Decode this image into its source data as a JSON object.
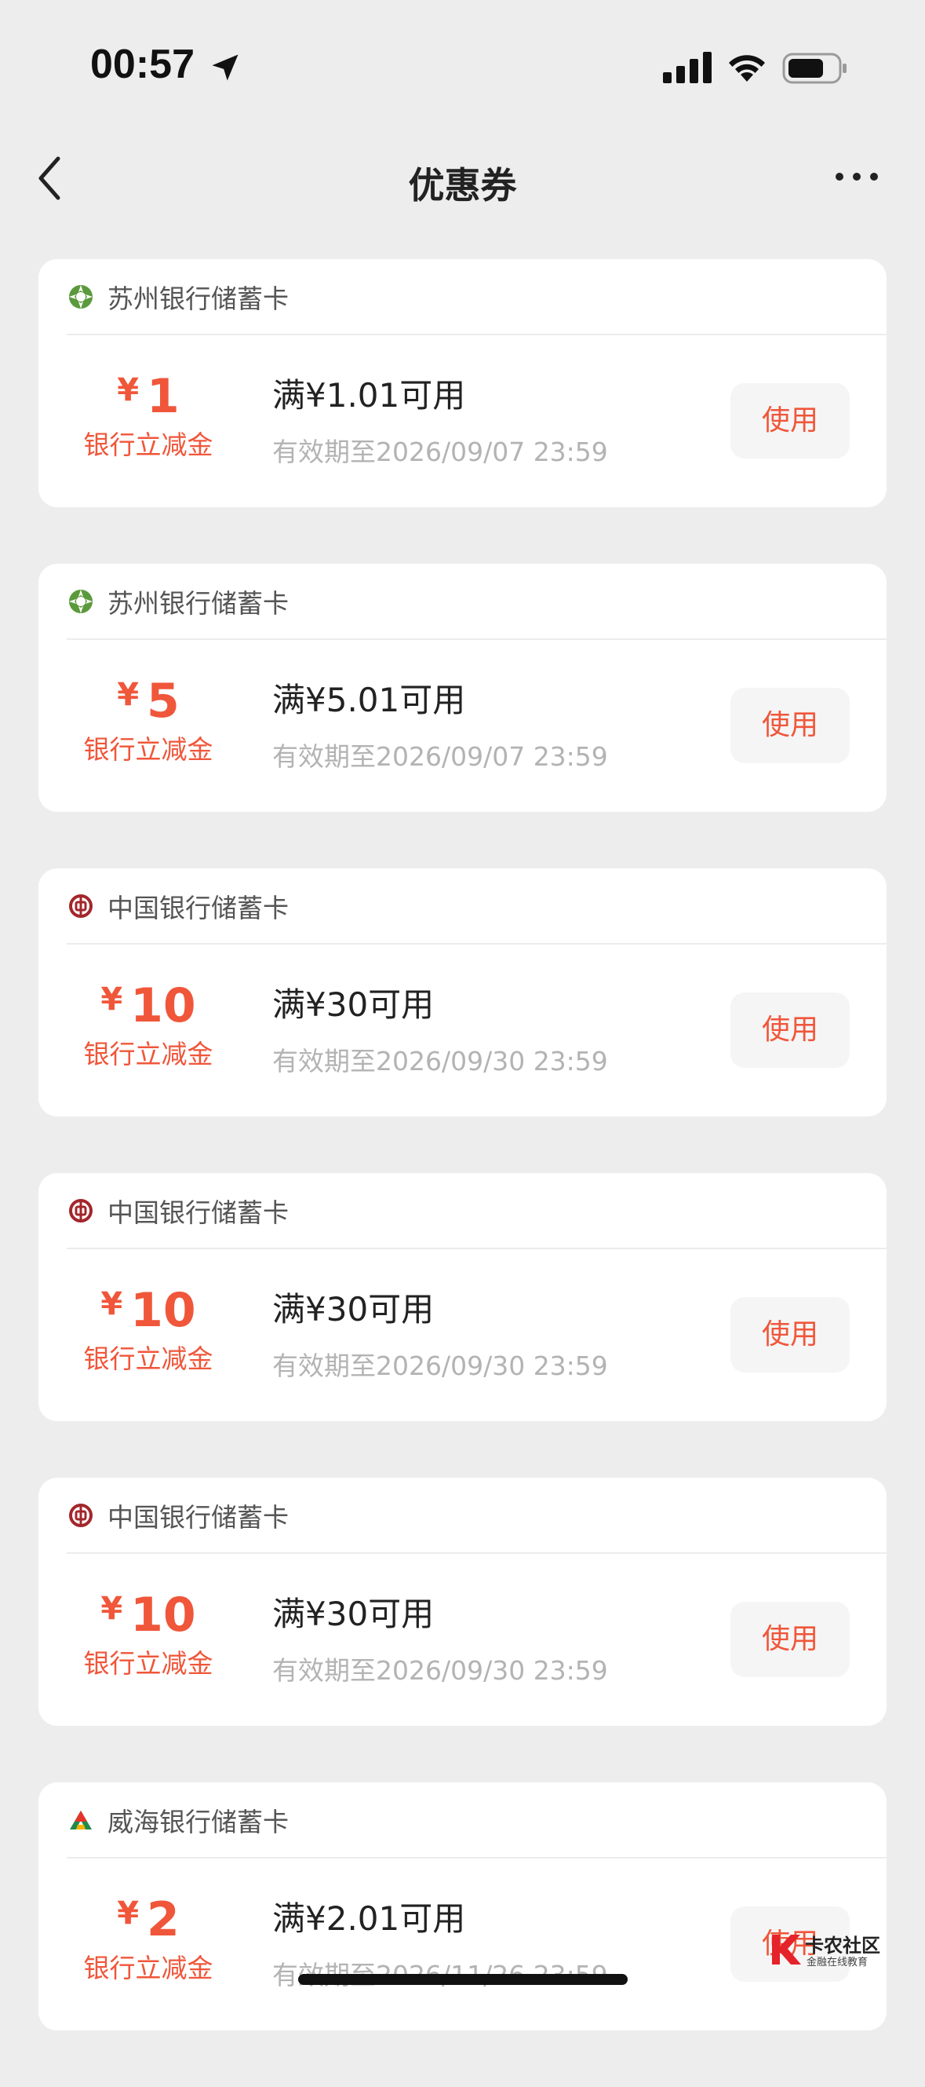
{
  "status_bar": {
    "time": "00:57"
  },
  "nav": {
    "title": "优惠券"
  },
  "colors": {
    "accent": "#f0563a",
    "background": "#ededed",
    "card": "#ffffff"
  },
  "coupons": [
    {
      "bank": "苏州银行储蓄卡",
      "logo": "suzhou-bank-logo",
      "currency": "¥",
      "amount": "1",
      "amount_label": "银行立减金",
      "condition": "满¥1.01可用",
      "expiry": "有效期至2026/09/07 23:59",
      "button": "使用"
    },
    {
      "bank": "苏州银行储蓄卡",
      "logo": "suzhou-bank-logo",
      "currency": "¥",
      "amount": "5",
      "amount_label": "银行立减金",
      "condition": "满¥5.01可用",
      "expiry": "有效期至2026/09/07 23:59",
      "button": "使用"
    },
    {
      "bank": "中国银行储蓄卡",
      "logo": "bank-of-china-logo",
      "currency": "¥",
      "amount": "10",
      "amount_label": "银行立减金",
      "condition": "满¥30可用",
      "expiry": "有效期至2026/09/30 23:59",
      "button": "使用"
    },
    {
      "bank": "中国银行储蓄卡",
      "logo": "bank-of-china-logo",
      "currency": "¥",
      "amount": "10",
      "amount_label": "银行立减金",
      "condition": "满¥30可用",
      "expiry": "有效期至2026/09/30 23:59",
      "button": "使用"
    },
    {
      "bank": "中国银行储蓄卡",
      "logo": "bank-of-china-logo",
      "currency": "¥",
      "amount": "10",
      "amount_label": "银行立减金",
      "condition": "满¥30可用",
      "expiry": "有效期至2026/09/30 23:59",
      "button": "使用"
    },
    {
      "bank": "威海银行储蓄卡",
      "logo": "weihai-bank-logo",
      "currency": "¥",
      "amount": "2",
      "amount_label": "银行立减金",
      "condition": "满¥2.01可用",
      "expiry": "有效期至2026/11/26 23:59",
      "button": "使用"
    }
  ],
  "watermark": {
    "title": "卡农社区",
    "subtitle": "金融在线教育"
  }
}
